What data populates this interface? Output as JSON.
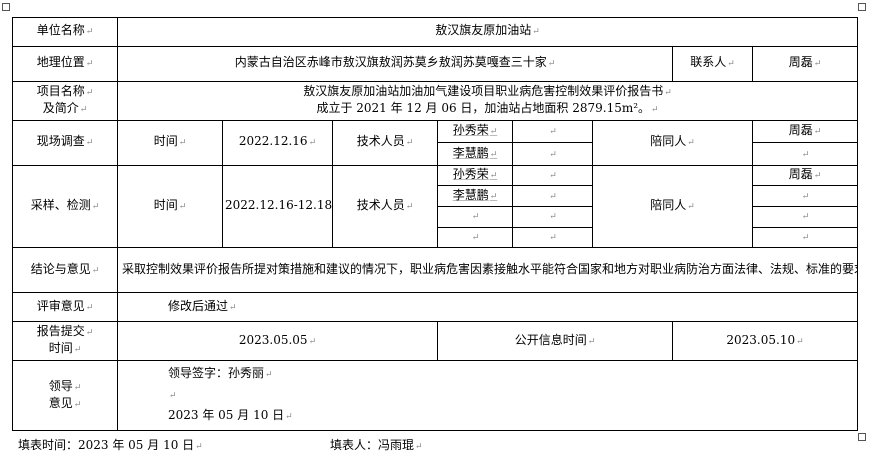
{
  "unit": {
    "label": "单位名称",
    "value": "敖汉旗友原加油站"
  },
  "location": {
    "label": "地理位置",
    "value": "内蒙古自治区赤峰市敖汉旗敖润苏莫乡敖润苏莫嘎查三十家",
    "contact_label": "联系人",
    "contact_value": "周磊"
  },
  "project": {
    "label_line1": "项目名称",
    "label_line2": "及简介",
    "desc_line1": "敖汉旗友原加油站加油加气建设项目职业病危害控制效果评价报告书",
    "desc_line2": "成立于 2021 年 12 月 06 日，加油站占地面积 2879.15m²。"
  },
  "survey": {
    "label": "现场调查",
    "time_label": "时间",
    "time_value": "2022.12.16",
    "tech_label": "技术人员",
    "techs": [
      "孙秀荣",
      "李慧鹏"
    ],
    "escort_label": "陪同人",
    "escorts": [
      "周磊",
      ""
    ]
  },
  "sampling": {
    "label": "采样、检测",
    "time_label": "时间",
    "time_value": "2022.12.16-12.18",
    "tech_label": "技术人员",
    "techs": [
      "孙秀荣",
      "李慧鹏",
      "",
      ""
    ],
    "escort_label": "陪同人",
    "escorts": [
      "周磊",
      "",
      "",
      ""
    ]
  },
  "conclusion": {
    "label": "结论与意见",
    "text": "采取控制效果评价报告所提对策措施和建议的情况下，职业病危害因素接触水平能符合国家和地方对职业病防治方面法律、法规、标准的要求。"
  },
  "review": {
    "label": "评审意见",
    "text": "修改后通过"
  },
  "submit": {
    "label_line1": "报告提交",
    "label_line2": "时间",
    "value": "2023.05.05",
    "public_label": "公开信息时间",
    "public_value": "2023.05.10"
  },
  "leader": {
    "label_line1": "领导",
    "label_line2": "意见",
    "sign": "领导签字：孙秀丽",
    "date": "2023 年 05 月 10 日"
  },
  "footer": {
    "fill_time": "填表时间：2023 年 05 月 10 日",
    "filler": "填表人：冯雨琨"
  },
  "marks": {
    "return": "↵"
  }
}
